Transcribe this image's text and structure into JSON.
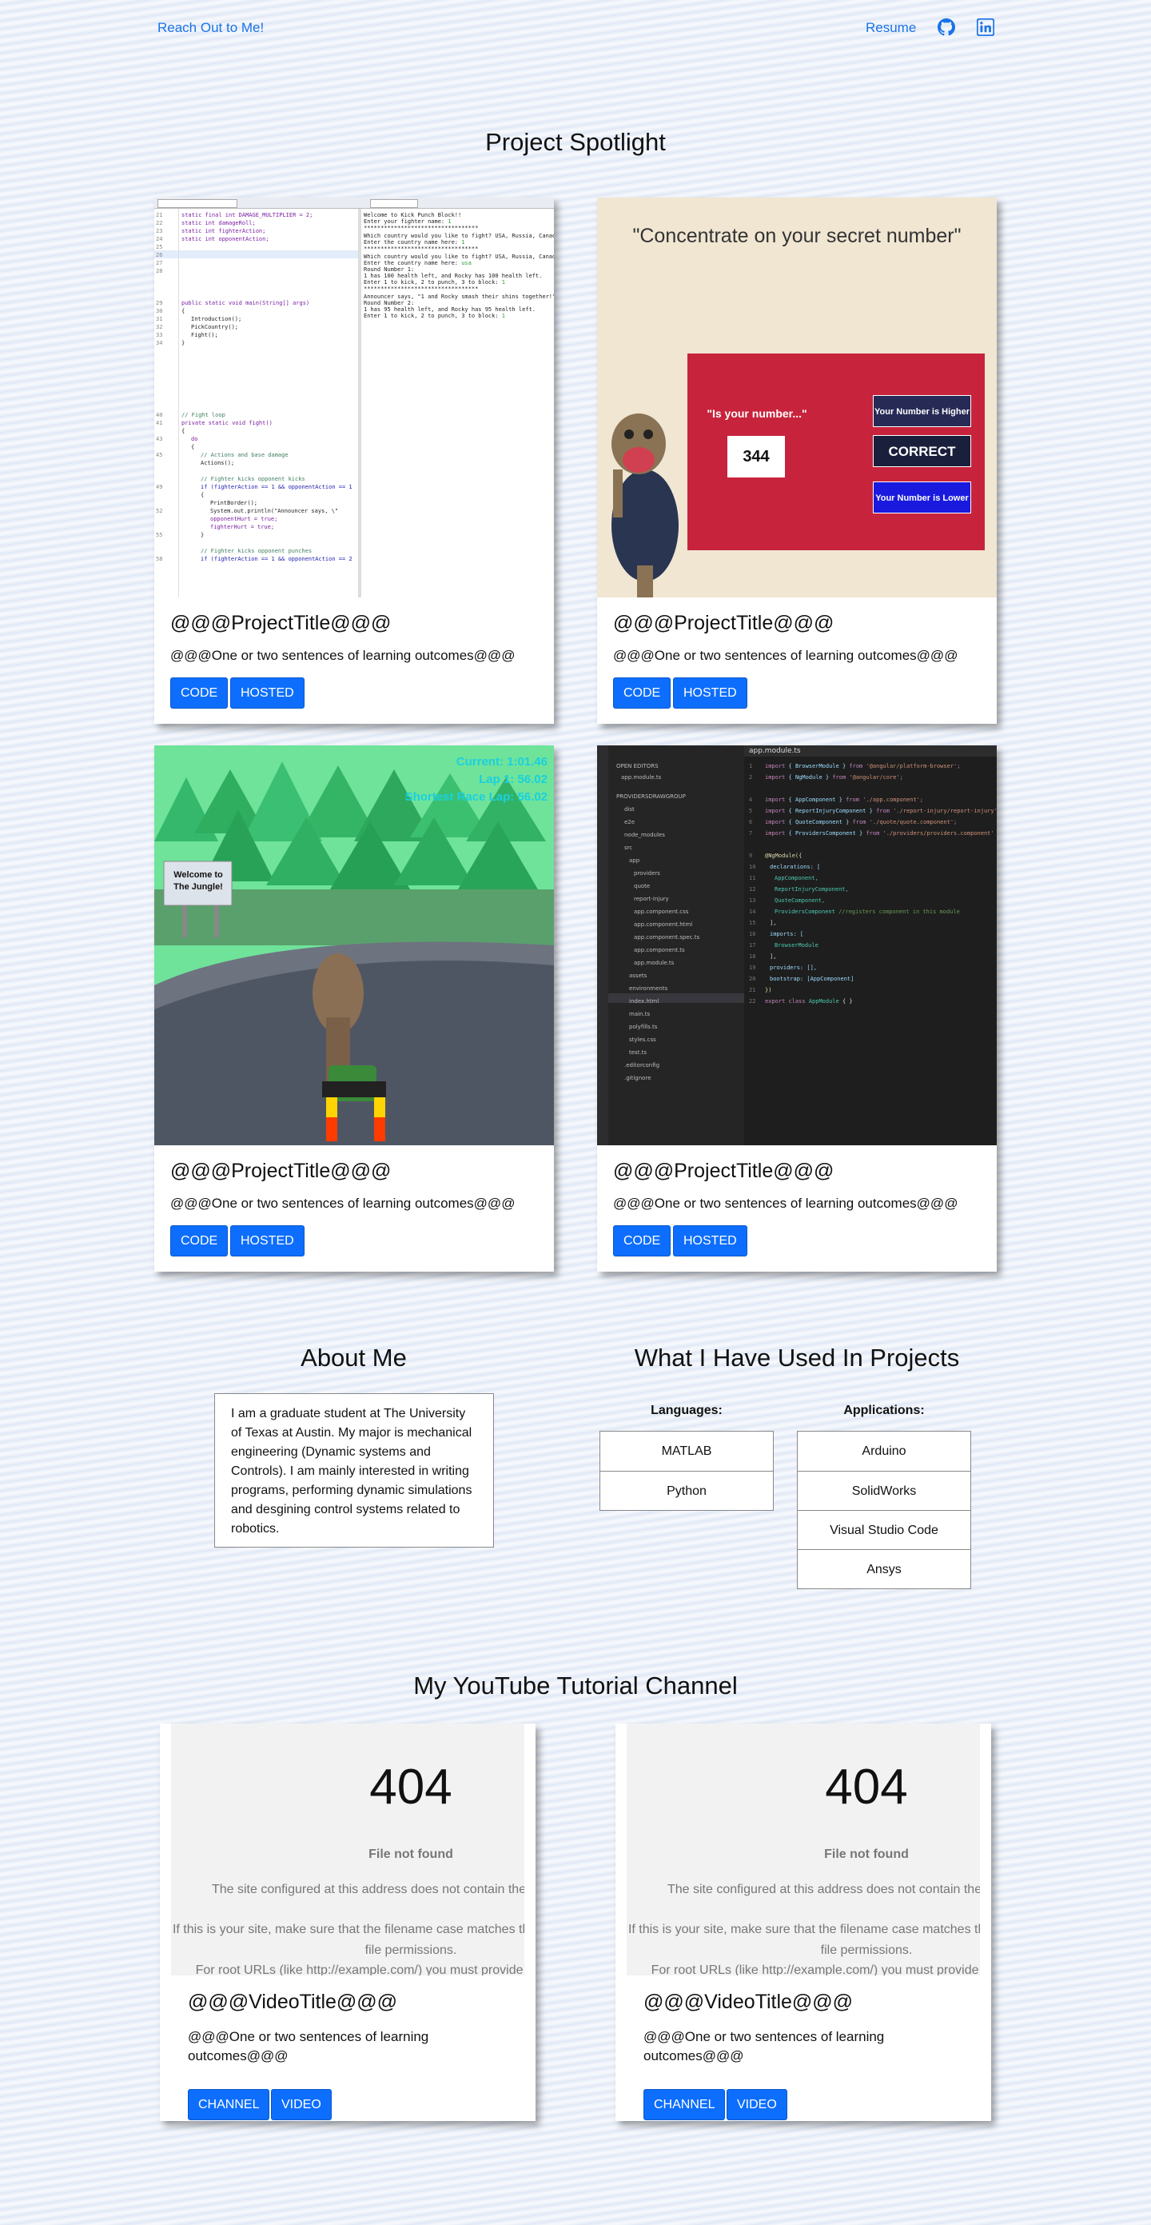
{
  "nav": {
    "home_link": "Reach Out to Me!",
    "resume_link": "Resume",
    "github_icon": "github-icon",
    "linkedin_icon": "linkedin-icon",
    "accent": "#1a73e8"
  },
  "spotlight": {
    "title": "Project Spotlight",
    "projects": [
      {
        "title": "@@@ProjectTitle@@@",
        "description": "@@@One or two sentences of learning outcomes@@@",
        "code_label": "CODE",
        "hosted_label": "HOSTED"
      },
      {
        "title": "@@@ProjectTitle@@@",
        "description": "@@@One or two sentences of learning outcomes@@@",
        "code_label": "CODE",
        "hosted_label": "HOSTED",
        "image_quote": "\"Concentrate on your secret number\"",
        "image_prompt": "\"Is your number...\"",
        "image_number": "344",
        "image_btn_higher": "Your Number is Higher",
        "image_btn_correct": "CORRECT",
        "image_btn_lower": "Your Number is Lower"
      },
      {
        "title": "@@@ProjectTitle@@@",
        "description": "@@@One or two sentences of learning outcomes@@@",
        "code_label": "CODE",
        "hosted_label": "HOSTED",
        "image_sign": "Welcome to The Jungle!",
        "image_hud": [
          "Current: 1:01.46",
          "Lap 1: 56.02",
          "Shortest Race Lap: 56.02"
        ]
      },
      {
        "title": "@@@ProjectTitle@@@",
        "description": "@@@One or two sentences of learning outcomes@@@",
        "code_label": "CODE",
        "hosted_label": "HOSTED",
        "image_tab": "app.module.ts"
      }
    ]
  },
  "about": {
    "title": "About Me",
    "text": "I am a graduate student at The University of Texas at Austin. My major is mechanical engineering (Dynamic systems and Controls). I am mainly interested in writing programs, performing dynamic simulations and desgining control systems related to robotics."
  },
  "tools": {
    "title": "What I Have Used In Projects",
    "languages_head": "Languages:",
    "languages": [
      "MATLAB",
      "Python"
    ],
    "applications_head": "Applications:",
    "applications": [
      "Arduino",
      "SolidWorks",
      "Visual Studio Code",
      "Ansys"
    ]
  },
  "youtube": {
    "title": "My YouTube Tutorial Channel",
    "videos": [
      {
        "error_code": "404",
        "error_title": "File not found",
        "error_line1": "The site configured at this address does not contain the requested file.",
        "error_line2": "If this is your site, make sure that the filename case matches the URL as well as any file permissions.",
        "error_line3": "For root URLs (like http://example.com/) you must provide an index.html file.",
        "title": "@@@VideoTitle@@@",
        "description": "@@@One or two sentences of learning outcomes@@@",
        "channel_label": "CHANNEL",
        "video_label": "VIDEO"
      },
      {
        "error_code": "404",
        "error_title": "File not found",
        "error_line1": "The site configured at this address does not contain the requested file.",
        "error_line2": "If this is your site, make sure that the filename case matches the URL as well as any file permissions.",
        "error_line3": "For root URLs (like http://example.com/) you must provide an index.html file.",
        "title": "@@@VideoTitle@@@",
        "description": "@@@One or two sentences of learning outcomes@@@",
        "channel_label": "CHANNEL",
        "video_label": "VIDEO"
      }
    ]
  },
  "colors": {
    "button_primary": "#0d6efd",
    "page_background": "#e8eef8"
  }
}
